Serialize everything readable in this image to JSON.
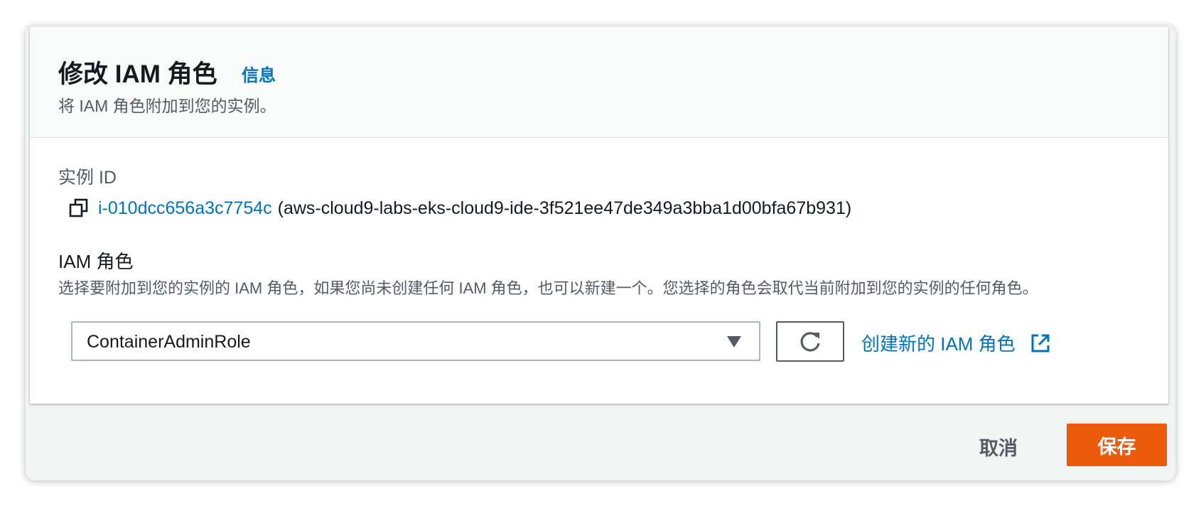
{
  "header": {
    "title": "修改 IAM 角色",
    "info_link": "信息",
    "subtitle": "将 IAM 角色附加到您的实例。"
  },
  "instance": {
    "label": "实例 ID",
    "id": "i-010dcc656a3c7754c",
    "name": "(aws-cloud9-labs-eks-cloud9-ide-3f521ee47de349a3bba1d00bfa67b931)",
    "copy_icon": "copy-icon"
  },
  "iam_role": {
    "label": "IAM 角色",
    "description": "选择要附加到您的实例的 IAM 角色，如果您尚未创建任何 IAM 角色，也可以新建一个。您选择的角色会取代当前附加到您的实例的任何角色。",
    "selected": "ContainerAdminRole",
    "caret_icon": "caret-down-icon",
    "refresh_icon": "refresh-icon",
    "create_link": "创建新的 IAM 角色",
    "external_icon": "external-link-icon"
  },
  "footer": {
    "cancel": "取消",
    "save": "保存"
  },
  "colors": {
    "link": "#0073bb",
    "primary": "#ec5a0c",
    "text": "#16191f",
    "secondary_text": "#545b64"
  }
}
